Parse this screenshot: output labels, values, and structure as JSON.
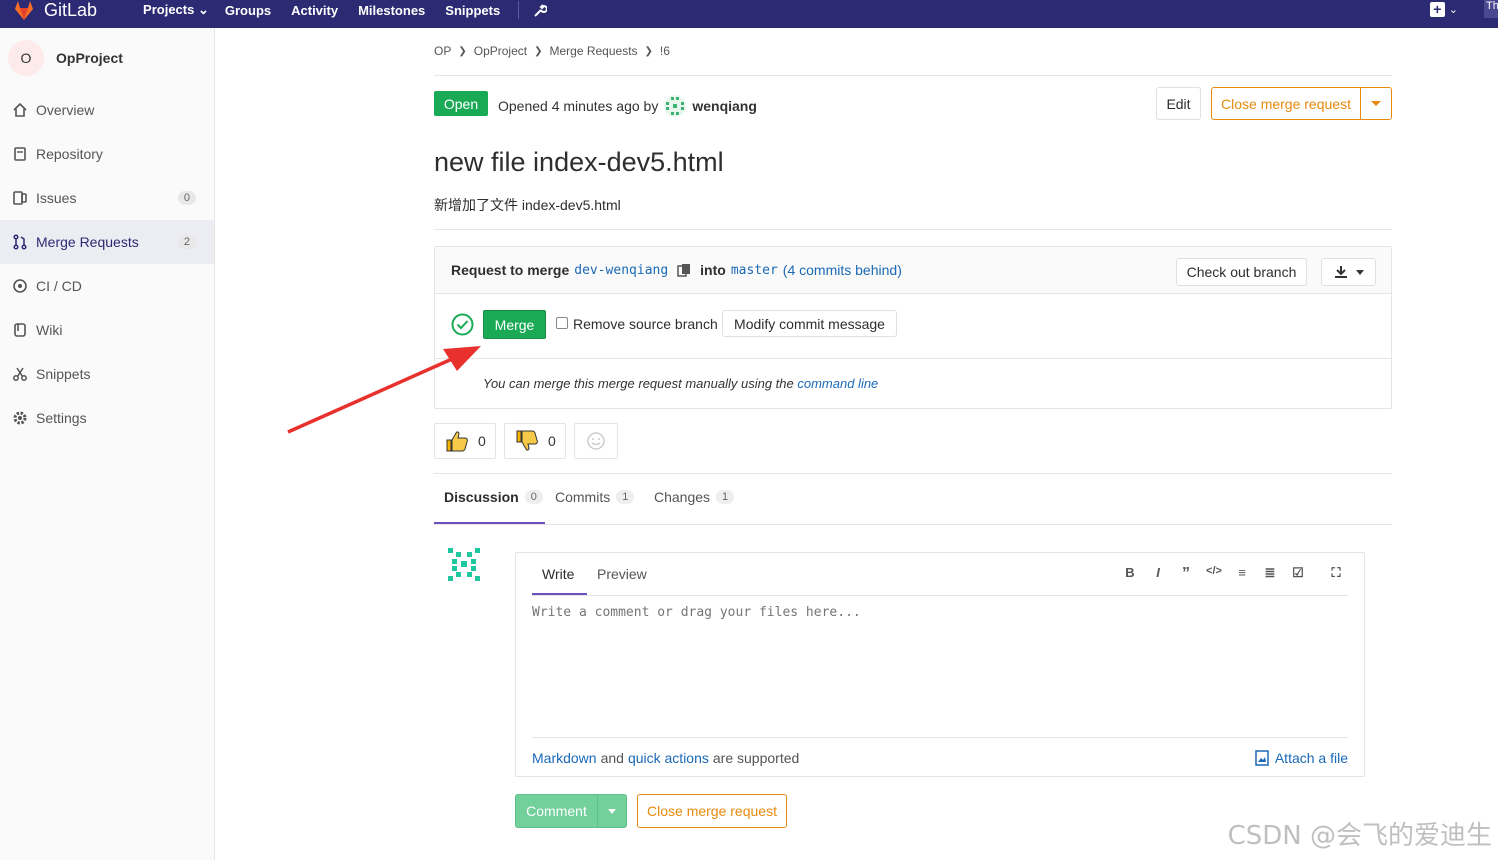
{
  "topnav": {
    "brand": "GitLab",
    "items": [
      "Projects",
      "Groups",
      "Activity",
      "Milestones",
      "Snippets"
    ],
    "edge_text": "Th"
  },
  "sidebar": {
    "avatar_letter": "O",
    "project_name": "OpProject",
    "items": [
      {
        "label": "Overview",
        "icon": "home-icon"
      },
      {
        "label": "Repository",
        "icon": "book-icon"
      },
      {
        "label": "Issues",
        "icon": "issues-icon",
        "count": "0"
      },
      {
        "label": "Merge Requests",
        "icon": "merge-request-icon",
        "count": "2",
        "active": true
      },
      {
        "label": "CI / CD",
        "icon": "rocket-icon"
      },
      {
        "label": "Wiki",
        "icon": "book-open-icon"
      },
      {
        "label": "Snippets",
        "icon": "scissors-icon"
      },
      {
        "label": "Settings",
        "icon": "gear-icon"
      }
    ]
  },
  "breadcrumb": [
    "OP",
    "OpProject",
    "Merge Requests",
    "!6"
  ],
  "mr": {
    "status": "Open",
    "opened_text": "Opened 4 minutes ago by",
    "author": "wenqiang",
    "edit_label": "Edit",
    "close_label": "Close merge request",
    "title": "new file index-dev5.html",
    "description": "新增加了文件 index-dev5.html",
    "request_to_merge": "Request to merge",
    "source_branch": "dev-wenqiang",
    "into": "into",
    "target_branch": "master",
    "behind_open": "(",
    "behind_link": "4 commits behind",
    "behind_close": ")",
    "checkout_label": "Check out branch",
    "merge_label": "Merge",
    "remove_source_label": "Remove source branch",
    "modify_commit_label": "Modify commit message",
    "manual_text": "You can merge this merge request manually using the",
    "command_line": "command line"
  },
  "awards": {
    "thumbs_up": "0",
    "thumbs_down": "0"
  },
  "tabs": [
    {
      "label": "Discussion",
      "count": "0",
      "active": true
    },
    {
      "label": "Commits",
      "count": "1"
    },
    {
      "label": "Changes",
      "count": "1"
    }
  ],
  "editor": {
    "write_tab": "Write",
    "preview_tab": "Preview",
    "toolbar": [
      "bold-icon",
      "italic-icon",
      "quote-icon",
      "code-icon",
      "bullet-list-icon",
      "numbered-list-icon",
      "task-list-icon",
      "fullscreen-icon"
    ],
    "placeholder": "Write a comment or drag your files here...",
    "markdown_link": "Markdown",
    "and_text": "and",
    "quick_actions_link": "quick actions",
    "supported_text": "are supported",
    "attach_label": "Attach a file"
  },
  "comment_label": "Comment",
  "close_bottom_label": "Close merge request",
  "watermark": "CSDN @会飞的爱迪生",
  "colors": {
    "nav": "#2b2a72",
    "success": "#1aaa55",
    "warning": "#e78a0f",
    "link": "#1b69b6",
    "annotation": "#e8302c"
  }
}
